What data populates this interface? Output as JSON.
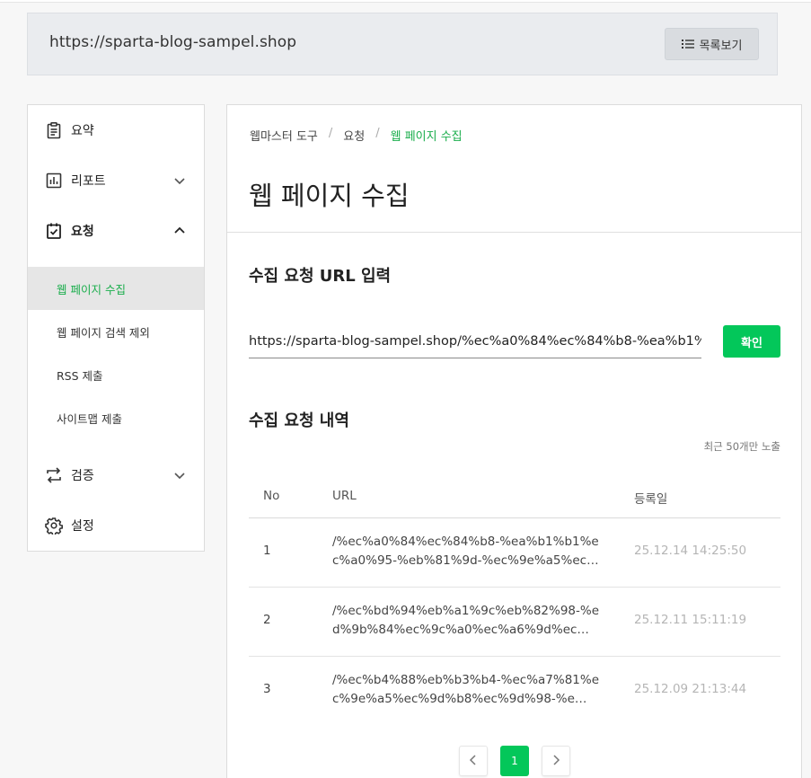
{
  "header": {
    "site_url": "https://sparta-blog-sampel.shop",
    "list_button_label": "목록보기"
  },
  "sidebar": {
    "items": [
      {
        "label": "요약",
        "icon": "clipboard-icon"
      },
      {
        "label": "리포트",
        "icon": "bar-chart-icon"
      },
      {
        "label": "요청",
        "icon": "clipboard-check-icon"
      },
      {
        "label": "검증",
        "icon": "swap-arrows-icon"
      },
      {
        "label": "설정",
        "icon": "gear-icon"
      }
    ],
    "sub_items": [
      {
        "label": "웹 페이지 수집"
      },
      {
        "label": "웹 페이지 검색 제외"
      },
      {
        "label": "RSS 제출"
      },
      {
        "label": "사이트맵 제출"
      }
    ]
  },
  "breadcrumb": [
    "웹마스터 도구",
    "요청",
    "웹 페이지 수집"
  ],
  "page_title": "웹 페이지 수집",
  "request_section": {
    "title": "수집 요청 URL 입력",
    "input_value": "https://sparta-blog-sampel.shop/%ec%a0%84%ec%84%b8-%ea%b1%",
    "confirm_label": "확인"
  },
  "history_section": {
    "title": "수집 요청 내역",
    "hint": "최근 50개만 노출",
    "columns": [
      "No",
      "URL",
      "등록일"
    ],
    "rows": [
      {
        "no": "1",
        "url": "/%ec%a0%84%ec%84%b8-%ea%b1%b1%ec%a0%95-%eb%81%9d-%ec%9e%a5%ec…",
        "date": "25.12.14 14:25:50"
      },
      {
        "no": "2",
        "url": "/%ec%bd%94%eb%a1%9c%eb%82%98-%ed%9b%84%ec%9c%a0%ec%a6%9d%ec…",
        "date": "25.12.11 15:11:19"
      },
      {
        "no": "3",
        "url": "/%ec%b4%88%eb%b3%b4-%ec%a7%81%ec%9e%a5%ec%9d%b8%ec%9d%98-%e…",
        "date": "25.12.09 21:13:44"
      }
    ]
  },
  "pagination": {
    "current_page": "1"
  },
  "colors": {
    "accent": "#03c75a",
    "active_text": "#19ad4b"
  }
}
